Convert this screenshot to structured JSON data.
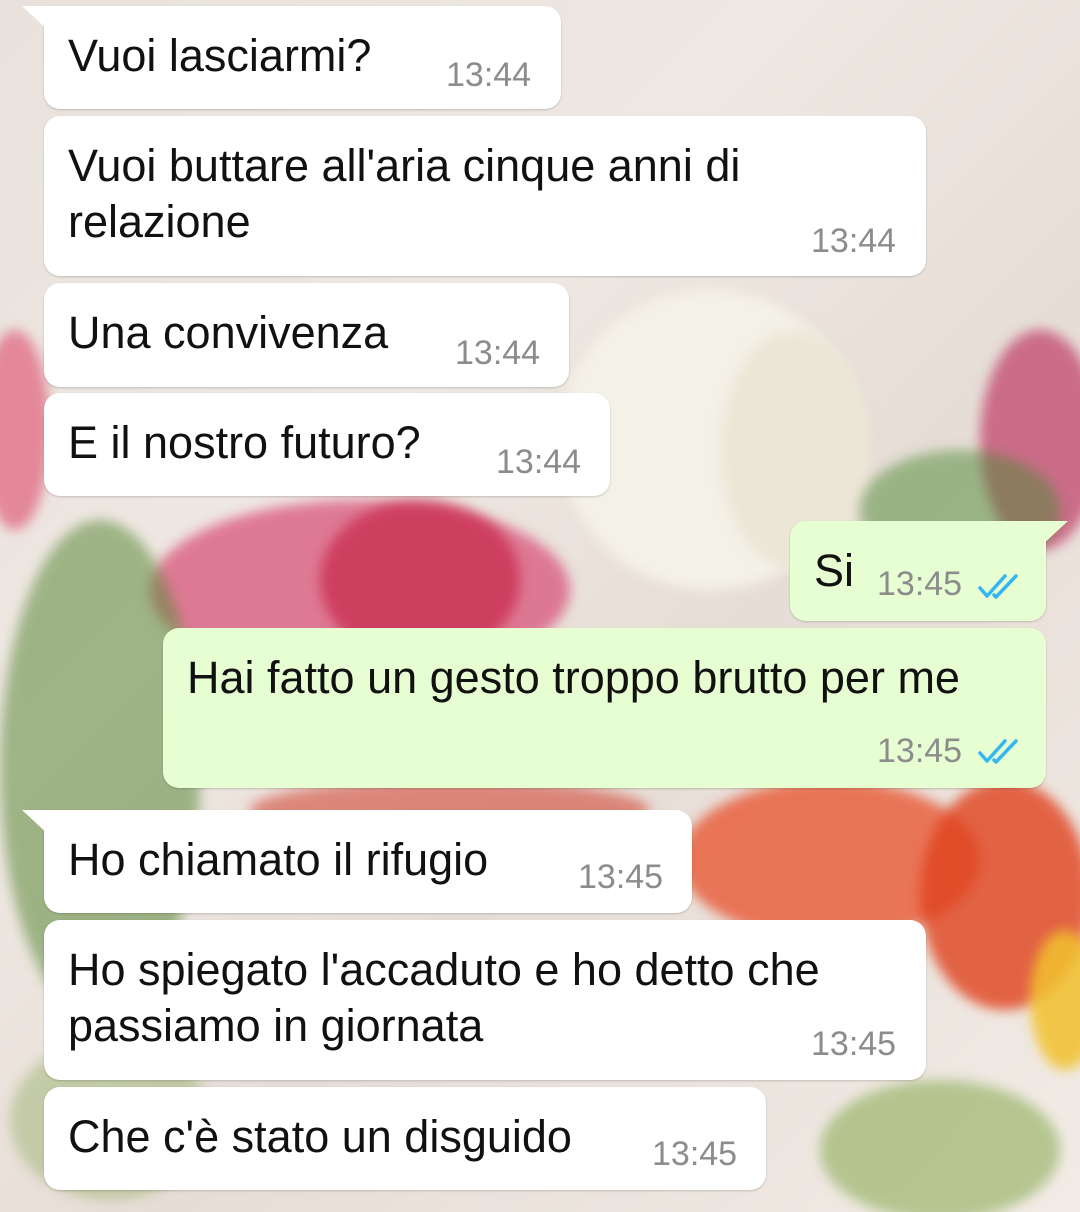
{
  "chat": {
    "messages": [
      {
        "direction": "incoming",
        "text": "Vuoi lasciarmi?",
        "time": "13:44"
      },
      {
        "direction": "incoming",
        "lines": [
          "Vuoi buttare all'aria cinque anni di",
          "relazione"
        ],
        "time": "13:44"
      },
      {
        "direction": "incoming",
        "text": "Una convivenza",
        "time": "13:44"
      },
      {
        "direction": "incoming",
        "text": "E il nostro futuro?",
        "time": "13:44"
      },
      {
        "direction": "outgoing",
        "text": "Si",
        "time": "13:45",
        "status_icon": "double-check-read-icon"
      },
      {
        "direction": "outgoing",
        "text": "Hai fatto un gesto troppo brutto per me",
        "time": "13:45",
        "status_icon": "double-check-read-icon"
      },
      {
        "direction": "incoming",
        "text": "Ho chiamato il rifugio",
        "time": "13:45"
      },
      {
        "direction": "incoming",
        "lines": [
          "Ho spiegato l'accaduto e ho detto che",
          "passiamo in giornata"
        ],
        "time": "13:45"
      },
      {
        "direction": "incoming",
        "text": "Che c'è stato un disguido",
        "time": "13:45"
      }
    ]
  },
  "colors": {
    "incoming_bubble": "#ffffff",
    "outgoing_bubble": "#e7fdd2",
    "timestamp": "#8c8c8c",
    "read_ticks": "#34b7f1"
  }
}
